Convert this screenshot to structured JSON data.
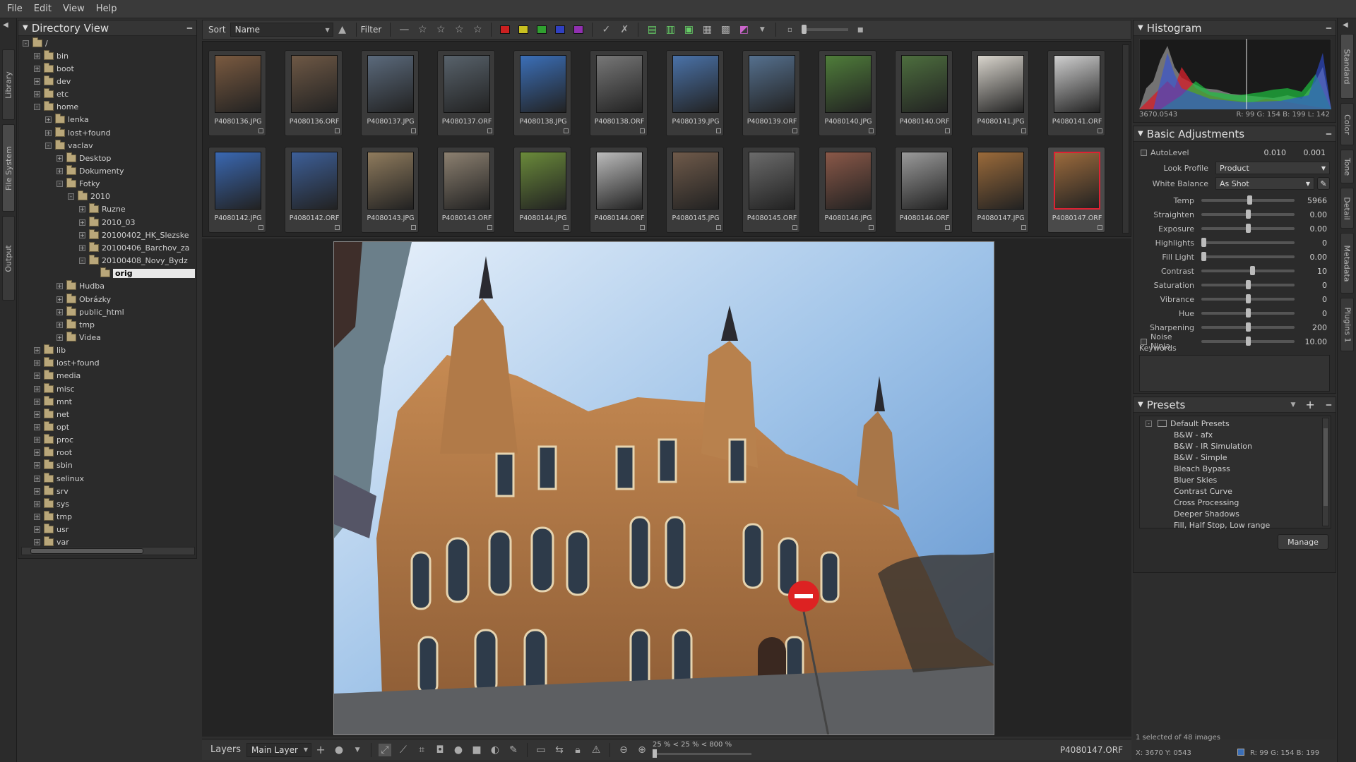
{
  "menu": [
    {
      "name": "menu-file",
      "label": "File"
    },
    {
      "name": "menu-edit",
      "label": "Edit"
    },
    {
      "name": "menu-view",
      "label": "View"
    },
    {
      "name": "menu-help",
      "label": "Help"
    }
  ],
  "left_tabs": [
    "Library",
    "File System",
    "Output"
  ],
  "right_tabs": [
    "Standard",
    "Color",
    "Tone",
    "Detail",
    "Metadata",
    "Plugins 1"
  ],
  "directory": {
    "title": "Directory View",
    "tree": [
      {
        "label": "/",
        "level": 0,
        "exp": "-"
      },
      {
        "label": "bin",
        "level": 1,
        "exp": "+"
      },
      {
        "label": "boot",
        "level": 1,
        "exp": "+"
      },
      {
        "label": "dev",
        "level": 1,
        "exp": "+"
      },
      {
        "label": "etc",
        "level": 1,
        "exp": "+"
      },
      {
        "label": "home",
        "level": 1,
        "exp": "-"
      },
      {
        "label": "lenka",
        "level": 2,
        "exp": "+"
      },
      {
        "label": "lost+found",
        "level": 2,
        "exp": "+"
      },
      {
        "label": "vaclav",
        "level": 2,
        "exp": "-"
      },
      {
        "label": "Desktop",
        "level": 3,
        "exp": "+"
      },
      {
        "label": "Dokumenty",
        "level": 3,
        "exp": "+"
      },
      {
        "label": "Fotky",
        "level": 3,
        "exp": "-"
      },
      {
        "label": "2010",
        "level": 4,
        "exp": "-"
      },
      {
        "label": "Ruzne",
        "level": 5,
        "exp": "+"
      },
      {
        "label": "2010_03",
        "level": 5,
        "exp": "+"
      },
      {
        "label": "20100402_HK_Slezske",
        "level": 5,
        "exp": "+"
      },
      {
        "label": "20100406_Barchov_za",
        "level": 5,
        "exp": "+"
      },
      {
        "label": "20100408_Novy_Bydz",
        "level": 5,
        "exp": "-"
      },
      {
        "label": "orig",
        "level": 6,
        "exp": "",
        "selected": true
      },
      {
        "label": "Hudba",
        "level": 3,
        "exp": "+"
      },
      {
        "label": "Obrázky",
        "level": 3,
        "exp": "+"
      },
      {
        "label": "public_html",
        "level": 3,
        "exp": "+"
      },
      {
        "label": "tmp",
        "level": 3,
        "exp": "+"
      },
      {
        "label": "Videa",
        "level": 3,
        "exp": "+"
      },
      {
        "label": "lib",
        "level": 1,
        "exp": "+"
      },
      {
        "label": "lost+found",
        "level": 1,
        "exp": "+"
      },
      {
        "label": "media",
        "level": 1,
        "exp": "+"
      },
      {
        "label": "misc",
        "level": 1,
        "exp": "+"
      },
      {
        "label": "mnt",
        "level": 1,
        "exp": "+"
      },
      {
        "label": "net",
        "level": 1,
        "exp": "+"
      },
      {
        "label": "opt",
        "level": 1,
        "exp": "+"
      },
      {
        "label": "proc",
        "level": 1,
        "exp": "+"
      },
      {
        "label": "root",
        "level": 1,
        "exp": "+"
      },
      {
        "label": "sbin",
        "level": 1,
        "exp": "+"
      },
      {
        "label": "selinux",
        "level": 1,
        "exp": "+"
      },
      {
        "label": "srv",
        "level": 1,
        "exp": "+"
      },
      {
        "label": "sys",
        "level": 1,
        "exp": "+"
      },
      {
        "label": "tmp",
        "level": 1,
        "exp": "+"
      },
      {
        "label": "usr",
        "level": 1,
        "exp": "+"
      },
      {
        "label": "var",
        "level": 1,
        "exp": "+"
      }
    ]
  },
  "toolbar": {
    "sort_label": "Sort",
    "sort_value": "Name",
    "filter_label": "Filter",
    "color_labels": [
      "#cc2020",
      "#c8c020",
      "#30a030",
      "#3040c0",
      "#9030b0"
    ]
  },
  "thumbnails": [
    {
      "file": "P4080136.JPG",
      "tone": "#7a5a40"
    },
    {
      "file": "P4080136.ORF",
      "tone": "#6e5845"
    },
    {
      "file": "P4080137.JPG",
      "tone": "#5b6a7c"
    },
    {
      "file": "P4080137.ORF",
      "tone": "#58626b"
    },
    {
      "file": "P4080138.JPG",
      "tone": "#3b6fb8"
    },
    {
      "file": "P4080138.ORF",
      "tone": "#777777"
    },
    {
      "file": "P4080139.JPG",
      "tone": "#4a72a8"
    },
    {
      "file": "P4080139.ORF",
      "tone": "#55708e"
    },
    {
      "file": "P4080140.JPG",
      "tone": "#4f7d3a"
    },
    {
      "file": "P4080140.ORF",
      "tone": "#4d6e3e"
    },
    {
      "file": "P4080141.JPG",
      "tone": "#d8d4cc"
    },
    {
      "file": "P4080141.ORF",
      "tone": "#cfcfcf"
    },
    {
      "file": "P4080142.JPG",
      "tone": "#3a68b2"
    },
    {
      "file": "P4080142.ORF",
      "tone": "#3d5f98"
    },
    {
      "file": "P4080143.JPG",
      "tone": "#8f7b5d"
    },
    {
      "file": "P4080143.ORF",
      "tone": "#8c8070"
    },
    {
      "file": "P4080144.JPG",
      "tone": "#6a8a3a"
    },
    {
      "file": "P4080144.ORF",
      "tone": "#bbbbbb"
    },
    {
      "file": "P4080145.JPG",
      "tone": "#6f5a4a"
    },
    {
      "file": "P4080145.ORF",
      "tone": "#6b6b6b"
    },
    {
      "file": "P4080146.JPG",
      "tone": "#8a5848"
    },
    {
      "file": "P4080146.ORF",
      "tone": "#9a9a9a"
    },
    {
      "file": "P4080147.JPG",
      "tone": "#9a6a3a"
    },
    {
      "file": "P4080147.ORF",
      "tone": "#9b6a3c",
      "selected": true
    }
  ],
  "bottombar": {
    "layers_label": "Layers",
    "layer_value": "Main Layer",
    "zoom_text": "25 % < 25 % < 800 %",
    "filename": "P4080147.ORF"
  },
  "histogram": {
    "title": "Histogram",
    "info_left": "3670.0543",
    "info_right": "R: 99  G: 154 B: 199  L: 142"
  },
  "basic": {
    "title": "Basic Adjustments",
    "autolevel_label": "AutoLevel",
    "autolevel_v1": "0.010",
    "autolevel_v2": "0.001",
    "look_profile_label": "Look Profile",
    "look_profile_value": "Product",
    "white_balance_label": "White Balance",
    "white_balance_value": "As Shot",
    "sliders": [
      {
        "name": "Temp",
        "value": "5966",
        "pos": 0.52
      },
      {
        "name": "Straighten",
        "value": "0.00",
        "pos": 0.5
      },
      {
        "name": "Exposure",
        "value": "0.00",
        "pos": 0.5
      },
      {
        "name": "Highlights",
        "value": "0",
        "pos": 0.0
      },
      {
        "name": "Fill Light",
        "value": "0.00",
        "pos": 0.0
      },
      {
        "name": "Contrast",
        "value": "10",
        "pos": 0.55
      },
      {
        "name": "Saturation",
        "value": "0",
        "pos": 0.5
      },
      {
        "name": "Vibrance",
        "value": "0",
        "pos": 0.5
      },
      {
        "name": "Hue",
        "value": "0",
        "pos": 0.5
      },
      {
        "name": "Sharpening",
        "value": "200",
        "pos": 0.5
      },
      {
        "name": "Noise Ninja",
        "value": "10.00",
        "pos": 0.5
      }
    ],
    "keywords_label": "Keywords"
  },
  "presets": {
    "title": "Presets",
    "group": "Default Presets",
    "items": [
      "B&W - afx",
      "B&W - IR Simulation",
      "B&W - Simple",
      "Bleach Bypass",
      "Bluer Skies",
      "Contrast Curve",
      "Cross Processing",
      "Deeper Shadows",
      "Fill, Half Stop, Low range"
    ],
    "manage_label": "Manage"
  },
  "status": {
    "selection": "1 selected of 48 images",
    "coords": "X: 3670 Y: 0543",
    "rgb": "R:  99   G:  154   B:  199"
  }
}
